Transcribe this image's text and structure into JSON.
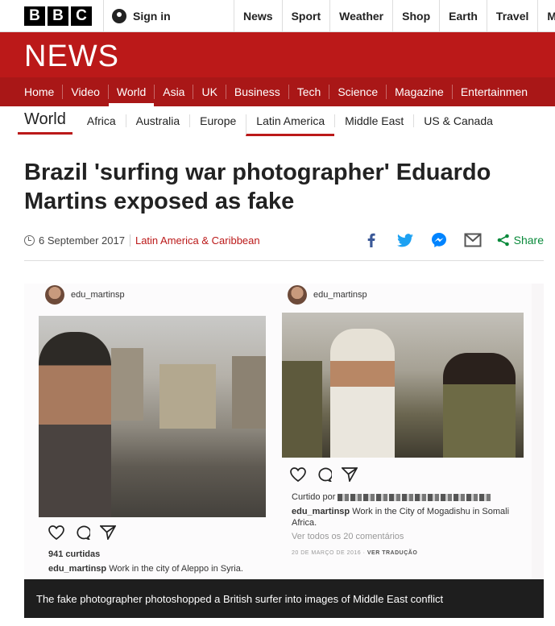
{
  "topbar": {
    "logo_letters": [
      "B",
      "B",
      "C"
    ],
    "signin_label": "Sign in",
    "links": [
      "News",
      "Sport",
      "Weather",
      "Shop",
      "Earth",
      "Travel",
      "Mo"
    ]
  },
  "banner": {
    "title": "NEWS"
  },
  "mainnav": {
    "items": [
      "Home",
      "Video",
      "World",
      "Asia",
      "UK",
      "Business",
      "Tech",
      "Science",
      "Magazine",
      "Entertainmen"
    ],
    "active": "World"
  },
  "subnav": {
    "section": "World",
    "items": [
      "Africa",
      "Australia",
      "Europe",
      "Latin America",
      "Middle East",
      "US & Canada"
    ],
    "active": "Latin America"
  },
  "article": {
    "headline": "Brazil 'surfing war photographer' Eduardo Martins exposed as fake",
    "date": "6 September 2017",
    "category": "Latin America & Caribbean",
    "share_label": "Share"
  },
  "figure": {
    "post_left": {
      "handle": "edu_martinsp",
      "likes": "941 curtidas",
      "caption_user": "edu_martinsp",
      "caption_text": "Work in the city of Aleppo in Syria."
    },
    "post_right": {
      "handle": "edu_martinsp",
      "liked_by": "Curtido por",
      "caption_user": "edu_martinsp",
      "caption_text": "Work in the City of Mogadishu in Somali Africa.",
      "comments": "Ver todos os 20 comentários",
      "date": "20 DE MARÇO DE 2016 ·",
      "translate": "VER TRADUÇÃO"
    },
    "caption": "The fake photographer photoshopped a British surfer into images of Middle East conflict"
  },
  "colors": {
    "brand_red": "#bb1919",
    "nav_red": "#a91717",
    "share_green": "#0a8a3b"
  }
}
